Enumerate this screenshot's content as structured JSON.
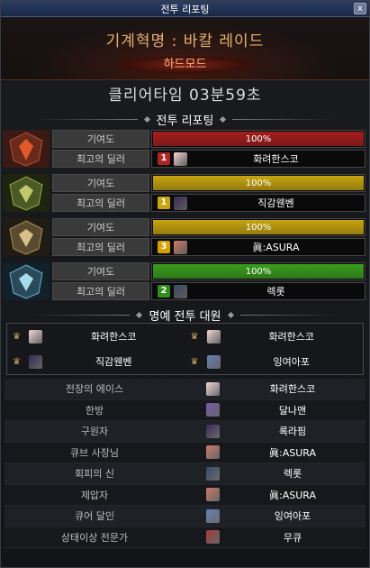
{
  "window": {
    "title": "전투 리포팅",
    "close": "x"
  },
  "raid": {
    "title": "기계혁명 : 바칼 레이드",
    "mode": "하드모드"
  },
  "clear_time": "클리어타임  03분59초",
  "battle_section": "전투 리포팅",
  "labels": {
    "contribution": "기여도",
    "top_dealer": "최고의 딜러"
  },
  "parties": [
    {
      "contribution": "100%",
      "contribution_fraction": 1.0,
      "bar_color": "#a51e1e",
      "rank": "1",
      "rank_color": "#b02424",
      "dealer": "화려한스코",
      "avatar_color": "#f2d4d2"
    },
    {
      "contribution": "100%",
      "contribution_fraction": 1.0,
      "bar_color": "#c7a410",
      "rank": "1",
      "rank_color": "#c7a410",
      "dealer": "직감웬벤",
      "avatar_color": "#3a2a55"
    },
    {
      "contribution": "100%",
      "contribution_fraction": 1.0,
      "bar_color": "#c7a410",
      "rank": "3",
      "rank_color": "#d4a100",
      "dealer": "眞:ASURA",
      "avatar_color": "#d07a68"
    },
    {
      "contribution": "100%",
      "contribution_fraction": 1.0,
      "bar_color": "#3a9e1e",
      "rank": "2",
      "rank_color": "#2e8f1a",
      "dealer": "렉롯",
      "avatar_color": "#3a4a66"
    }
  ],
  "honor_section": "명예 전투 대원",
  "honor": [
    {
      "name": "화려한스코",
      "avatar_color": "#f2d4d2"
    },
    {
      "name": "화려한스코",
      "avatar_color": "#f2d4d2"
    },
    {
      "name": "직감웬벤",
      "avatar_color": "#3a2a55"
    },
    {
      "name": "잉여아포",
      "avatar_color": "#6a7fb8"
    }
  ],
  "awards": [
    {
      "title": "전장의 에이스",
      "name": "화려한스코",
      "avatar_color": "#f2d4d2"
    },
    {
      "title": "한방",
      "name": "달나맨",
      "avatar_color": "#7a5aa8"
    },
    {
      "title": "구원자",
      "name": "록라핌",
      "avatar_color": "#3a2a55"
    },
    {
      "title": "큐브 사장님",
      "name": "眞:ASURA",
      "avatar_color": "#d07a68"
    },
    {
      "title": "회피의 신",
      "name": "렉롯",
      "avatar_color": "#3a4a66"
    },
    {
      "title": "제압자",
      "name": "眞:ASURA",
      "avatar_color": "#d07a68"
    },
    {
      "title": "큐어 달인",
      "name": "잉여아포",
      "avatar_color": "#6a7fb8"
    },
    {
      "title": "상태이상 전문가",
      "name": "무큐",
      "avatar_color": "#a83a3a"
    }
  ]
}
